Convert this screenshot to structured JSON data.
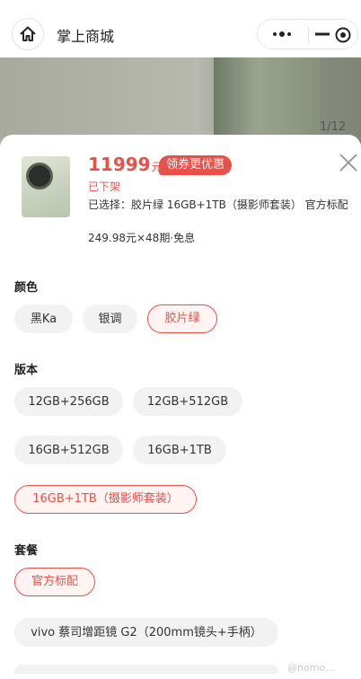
{
  "header": {
    "title": "掌上商城",
    "home_icon": "home-icon",
    "more_icon": "more-dots-icon",
    "minimize_icon": "minimize-icon",
    "close_icon": "target-close-icon"
  },
  "hero": {
    "page_indicator": "1/12"
  },
  "product": {
    "price": "11999",
    "price_unit": "元",
    "coupon_label": "领券更优惠",
    "status": "已下架",
    "selected_text": "已选择：胶片绿 16GB+1TB（摄影师套装） 官方标配",
    "installment": "249.98元×48期·免息",
    "accent_color": "#e8504a"
  },
  "sections": {
    "color": {
      "title": "颜色",
      "options": [
        "黑Ka",
        "银调",
        "胶片绿"
      ],
      "selected": "胶片绿"
    },
    "version": {
      "title": "版本",
      "options": [
        "12GB+256GB",
        "12GB+512GB",
        "16GB+512GB",
        "16GB+1TB",
        "16GB+1TB（摄影师套装）"
      ],
      "selected": "16GB+1TB（摄影师套装）"
    },
    "package": {
      "title": "套餐",
      "options": [
        "官方标配",
        "vivo 蔡司增距镜 G2（200mm镜头+手柄）"
      ],
      "selected": "官方标配"
    }
  },
  "watermark": "@nomo..."
}
